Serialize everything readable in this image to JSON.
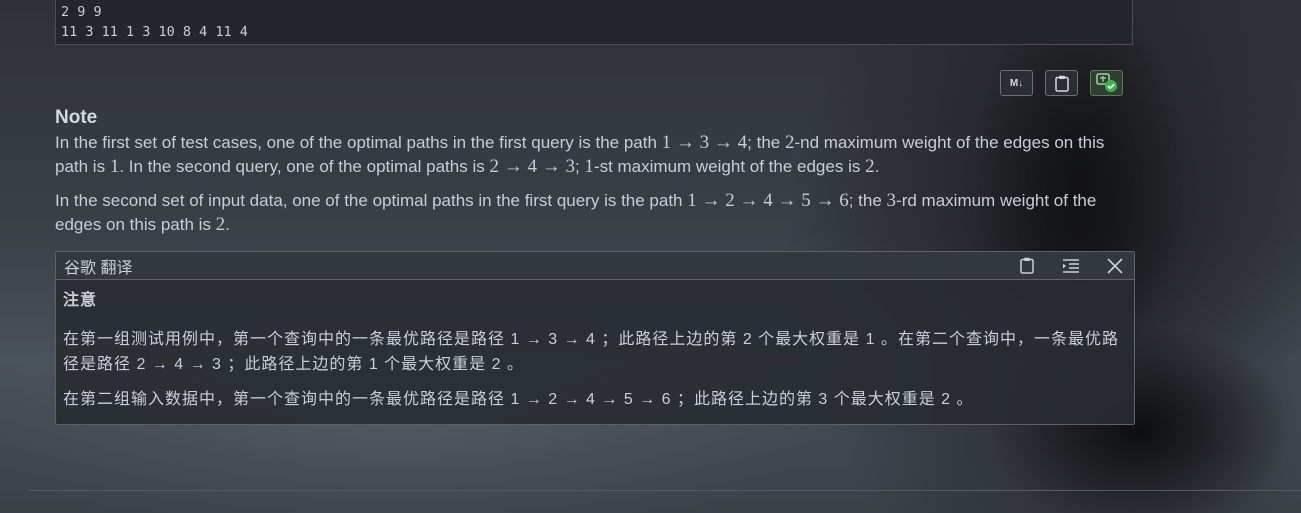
{
  "code": {
    "lines": [
      "2 9 9",
      "11 3 11 1 3 10 8 4 11 4"
    ]
  },
  "toolbar": {
    "markdown_label": "M↓",
    "markdown_icon": "markdown-icon",
    "copy_icon": "clipboard-icon",
    "translate_icon": "translate-check-icon"
  },
  "note": {
    "title": "Note",
    "p1": {
      "t1": "In the first set of test cases, one of the optimal paths in the first query is the path ",
      "m1": "1 → 3 → 4",
      "t2": "; the ",
      "m2": "2",
      "t3": "-nd maximum weight of the edges on this path is ",
      "m3": "1",
      "t4": ". In the second query, one of the optimal paths is ",
      "m4": "2 → 4 → 3",
      "t5": "; ",
      "m5": "1",
      "t6": "-st maximum weight of the edges is ",
      "m6": "2",
      "t7": "."
    },
    "p2": {
      "t1": "In the second set of input data, one of the optimal paths in the first query is the path ",
      "m1": "1 → 2 → 4 → 5 → 6",
      "t2": "; the ",
      "m2": "3",
      "t3": "-rd maximum weight of the edges on this path is ",
      "m3": "2",
      "t4": "."
    }
  },
  "translation": {
    "header": "谷歌 翻译",
    "title": "注意",
    "p1": "在第一组测试用例中，第一个查询中的一条最优路径是路径  1 → 3 → 4  ；此路径上边的第  2  个最大权重是  1  。在第二个查询中，一条最优路径是路径  2 → 4 → 3  ；此路径上边的第  1  个最大权重是  2  。",
    "p2": "在第二组输入数据中，第一个查询中的一条最优路径是路径  1 → 2 → 4 → 5 → 6  ；此路径上边的第  3  个最大权重是  2  。"
  }
}
